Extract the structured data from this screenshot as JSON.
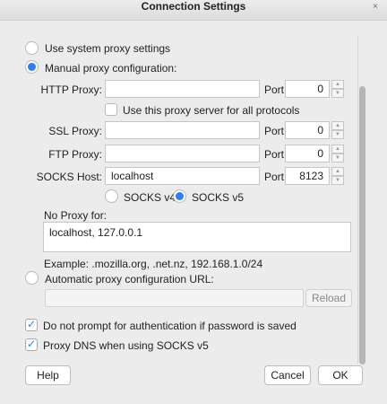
{
  "window": {
    "title": "Connection Settings",
    "close_glyph": "×"
  },
  "proxy_mode": {
    "system_label": "Use system proxy settings",
    "manual_label": "Manual proxy configuration:",
    "auto_label": "Automatic proxy configuration URL:",
    "selected": "manual"
  },
  "http": {
    "label": "HTTP Proxy:",
    "host": "",
    "port_label": "Port:",
    "port": "0"
  },
  "share_all": {
    "label": "Use this proxy server for all protocols",
    "checked": false
  },
  "ssl": {
    "label": "SSL Proxy:",
    "host": "",
    "port_label": "Port:",
    "port": "0"
  },
  "ftp": {
    "label": "FTP Proxy:",
    "host": "",
    "port_label": "Port:",
    "port": "0"
  },
  "socks": {
    "label": "SOCKS Host:",
    "host": "localhost",
    "port_label": "Port:",
    "port": "8123",
    "v4_label": "SOCKS v4",
    "v5_label": "SOCKS v5",
    "version": "v5"
  },
  "no_proxy": {
    "label": "No Proxy for:",
    "value": "localhost, 127.0.0.1",
    "example": "Example: .mozilla.org, .net.nz, 192.168.1.0/24"
  },
  "auto_config": {
    "url": "",
    "reload_label": "Reload"
  },
  "options": {
    "no_auth_prompt_label": "Do not prompt for authentication if password is saved",
    "no_auth_prompt_checked": true,
    "proxy_dns_label": "Proxy DNS when using SOCKS v5",
    "proxy_dns_checked": true
  },
  "buttons": {
    "help": "Help",
    "cancel": "Cancel",
    "ok": "OK"
  },
  "colors": {
    "accent": "#2f7ef5",
    "background": "#ececec"
  }
}
